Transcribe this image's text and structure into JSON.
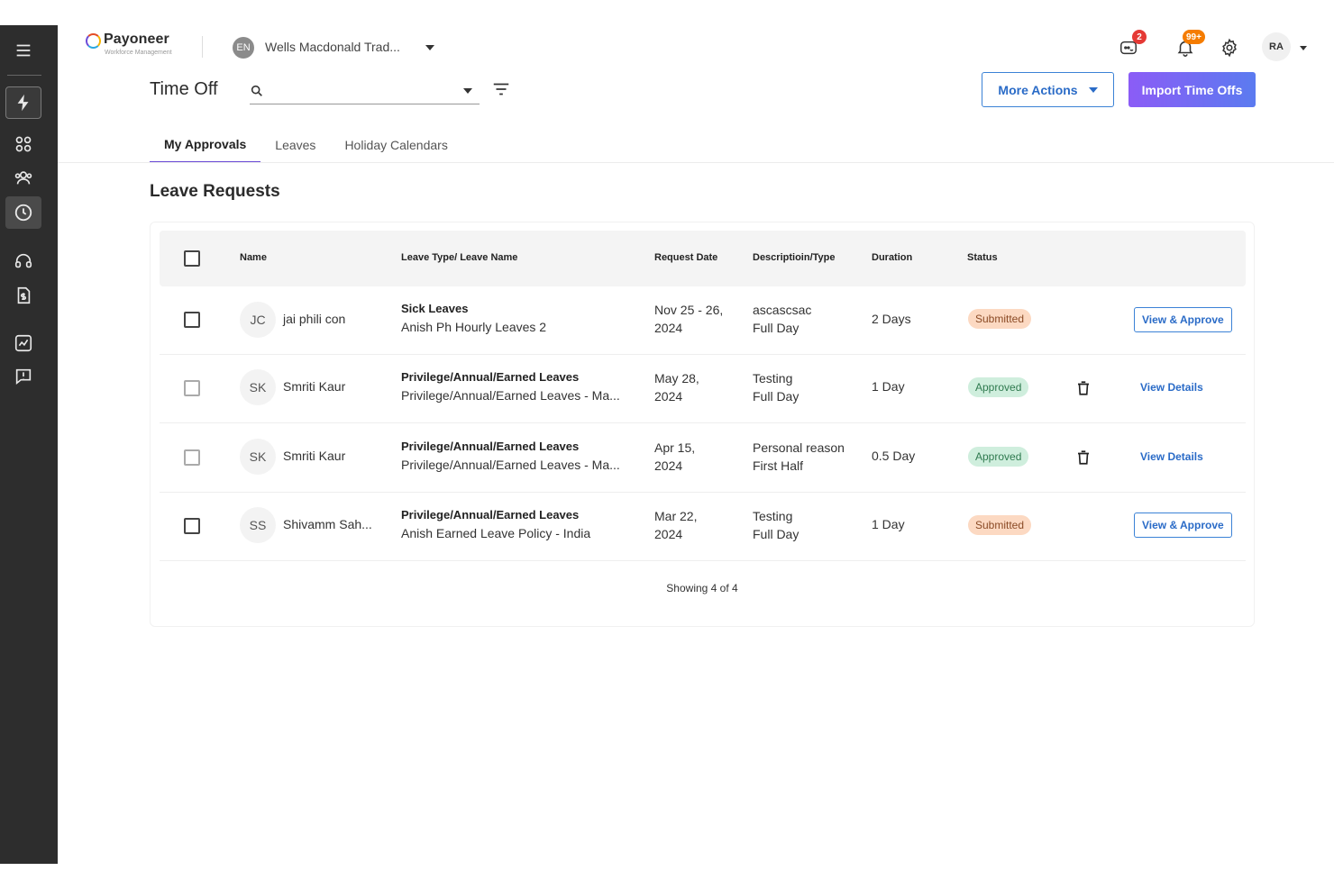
{
  "header": {
    "logo_name": "Payoneer",
    "logo_sub": "Workforce Management",
    "org_initials": "EN",
    "org_name": "Wells Macdonald Trad...",
    "chat_badge": "2",
    "notif_badge": "99+",
    "user_initials": "RA"
  },
  "page": {
    "title": "Time Off",
    "search_placeholder": "",
    "more_actions_label": "More Actions",
    "import_label": "Import Time Offs"
  },
  "tabs": [
    {
      "label": "My Approvals",
      "active": true
    },
    {
      "label": "Leaves",
      "active": false
    },
    {
      "label": "Holiday Calendars",
      "active": false
    }
  ],
  "section_title": "Leave Requests",
  "table": {
    "columns": [
      "Name",
      "Leave Type/ Leave Name",
      "Request Date",
      "Descriptioin/Type",
      "Duration",
      "Status"
    ],
    "rows": [
      {
        "initials": "JC",
        "name": "jai phili con",
        "leave_type": "Sick Leaves",
        "leave_name": "Anish Ph Hourly Leaves 2",
        "date1": "Nov 25 - 26,",
        "date2": "2024",
        "desc": "ascascsac",
        "desc_type": "Full Day",
        "duration": "2 Days",
        "status": "Submitted",
        "action": "View & Approve"
      },
      {
        "initials": "SK",
        "name": "Smriti Kaur",
        "leave_type": "Privilege/Annual/Earned Leaves",
        "leave_name": "Privilege/Annual/Earned Leaves - Ma...",
        "date1": "May 28,",
        "date2": "2024",
        "desc": "Testing",
        "desc_type": "Full Day",
        "duration": "1 Day",
        "status": "Approved",
        "action": "View Details"
      },
      {
        "initials": "SK",
        "name": "Smriti Kaur",
        "leave_type": "Privilege/Annual/Earned Leaves",
        "leave_name": "Privilege/Annual/Earned Leaves - Ma...",
        "date1": "Apr 15,",
        "date2": "2024",
        "desc": "Personal reason",
        "desc_type": "First Half",
        "duration": "0.5 Day",
        "status": "Approved",
        "action": "View Details"
      },
      {
        "initials": "SS",
        "name": "Shivamm Sah...",
        "leave_type": "Privilege/Annual/Earned Leaves",
        "leave_name": "Anish Earned Leave Policy - India",
        "date1": "Mar 22,",
        "date2": "2024",
        "desc": "Testing",
        "desc_type": "Full Day",
        "duration": "1 Day",
        "status": "Submitted",
        "action": "View & Approve"
      }
    ],
    "footer": "Showing 4 of 4"
  },
  "sidebar": {
    "icons": [
      "menu-icon",
      "lightning-icon",
      "apps-grid-icon",
      "people-icon",
      "clock-icon",
      "headset-icon",
      "invoice-icon",
      "analytics-icon",
      "feedback-icon"
    ]
  }
}
